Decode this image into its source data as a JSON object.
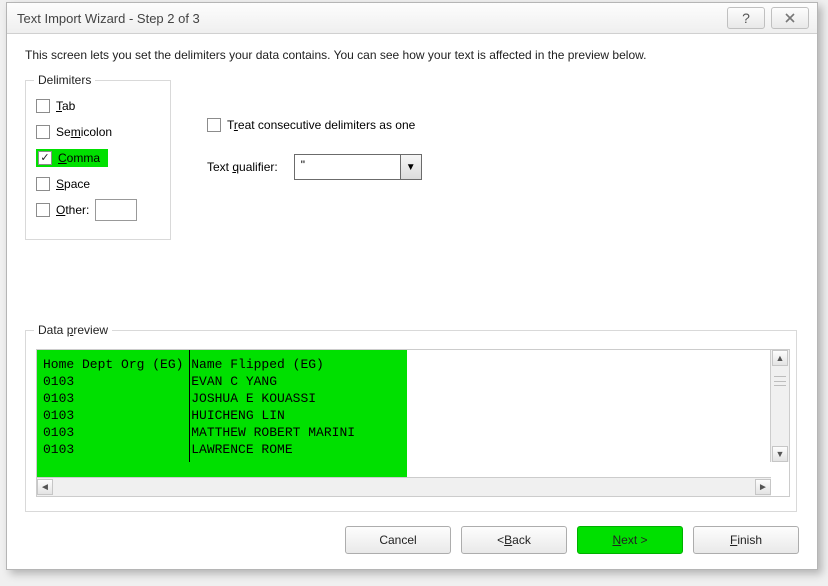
{
  "title": "Text Import Wizard - Step 2 of 3",
  "instruction": "This screen lets you set the delimiters your data contains.  You can see how your text is affected in the preview below.",
  "delimiters": {
    "legend": "Delimiters",
    "tab": {
      "label": "Tab",
      "checked": false
    },
    "semicolon": {
      "label": "Semicolon",
      "checked": false
    },
    "comma": {
      "label": "Comma",
      "checked": true
    },
    "space": {
      "label": "Space",
      "checked": false
    },
    "other": {
      "label": "Other:",
      "checked": false,
      "value": ""
    }
  },
  "treatConsecutive": {
    "label": "Treat consecutive delimiters as one",
    "checked": false
  },
  "textQualifier": {
    "label": "Text qualifier:",
    "value": "\""
  },
  "preview": {
    "legend": "Data preview",
    "columns": [
      "Home Dept Org (EG)",
      "Name Flipped (EG)"
    ],
    "rows": [
      [
        "0103",
        "EVAN C YANG"
      ],
      [
        "0103",
        "JOSHUA E KOUASSI"
      ],
      [
        "0103",
        "HUICHENG LIN"
      ],
      [
        "0103",
        "MATTHEW ROBERT MARINI"
      ],
      [
        "0103",
        "LAWRENCE ROME"
      ]
    ]
  },
  "buttons": {
    "cancel": "Cancel",
    "back": "< Back",
    "next": "Next >",
    "finish": "Finish"
  }
}
